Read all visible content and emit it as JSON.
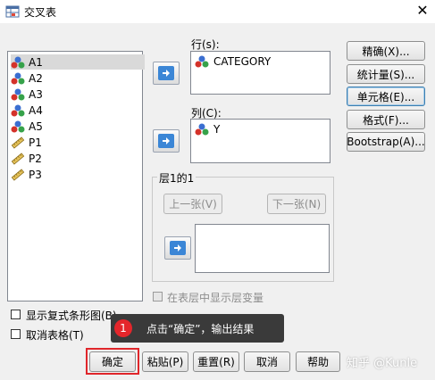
{
  "window": {
    "title": "交叉表",
    "close_glyph": "✕"
  },
  "variables": [
    {
      "name": "A1",
      "icon": "nominal-icon",
      "selected": true
    },
    {
      "name": "A2",
      "icon": "nominal-icon"
    },
    {
      "name": "A3",
      "icon": "nominal-icon"
    },
    {
      "name": "A4",
      "icon": "nominal-icon"
    },
    {
      "name": "A5",
      "icon": "nominal-icon"
    },
    {
      "name": "P1",
      "icon": "scale-icon"
    },
    {
      "name": "P2",
      "icon": "scale-icon"
    },
    {
      "name": "P3",
      "icon": "scale-icon"
    }
  ],
  "rows": {
    "label": "行(s):",
    "items": [
      "CATEGORY"
    ]
  },
  "columns": {
    "label": "列(C):",
    "items": [
      "Y"
    ]
  },
  "layer": {
    "group_label": "层1的1",
    "prev_label": "上一张(V)",
    "next_label": "下一张(N)"
  },
  "layer_checkbox": "在表层中显示层变量",
  "side_buttons": [
    "精确(X)...",
    "统计量(S)...",
    "单元格(E)...",
    "格式(F)...",
    "Bootstrap(A)..."
  ],
  "options": {
    "clustered_bar": "显示复式条形图(B)",
    "suppress_tables": "取消表格(T)"
  },
  "bottom_buttons": {
    "ok": "确定",
    "paste": "粘贴(P)",
    "reset": "重置(R)",
    "cancel": "取消",
    "help": "帮助"
  },
  "annotation": {
    "number": "1",
    "text": "点击“确定”，输出结果"
  },
  "watermark": "知乎 @Kunle",
  "colors": {
    "accent": "#3b86d6",
    "tooltip_bg": "#3a3a3a",
    "badge": "#e4262b"
  }
}
